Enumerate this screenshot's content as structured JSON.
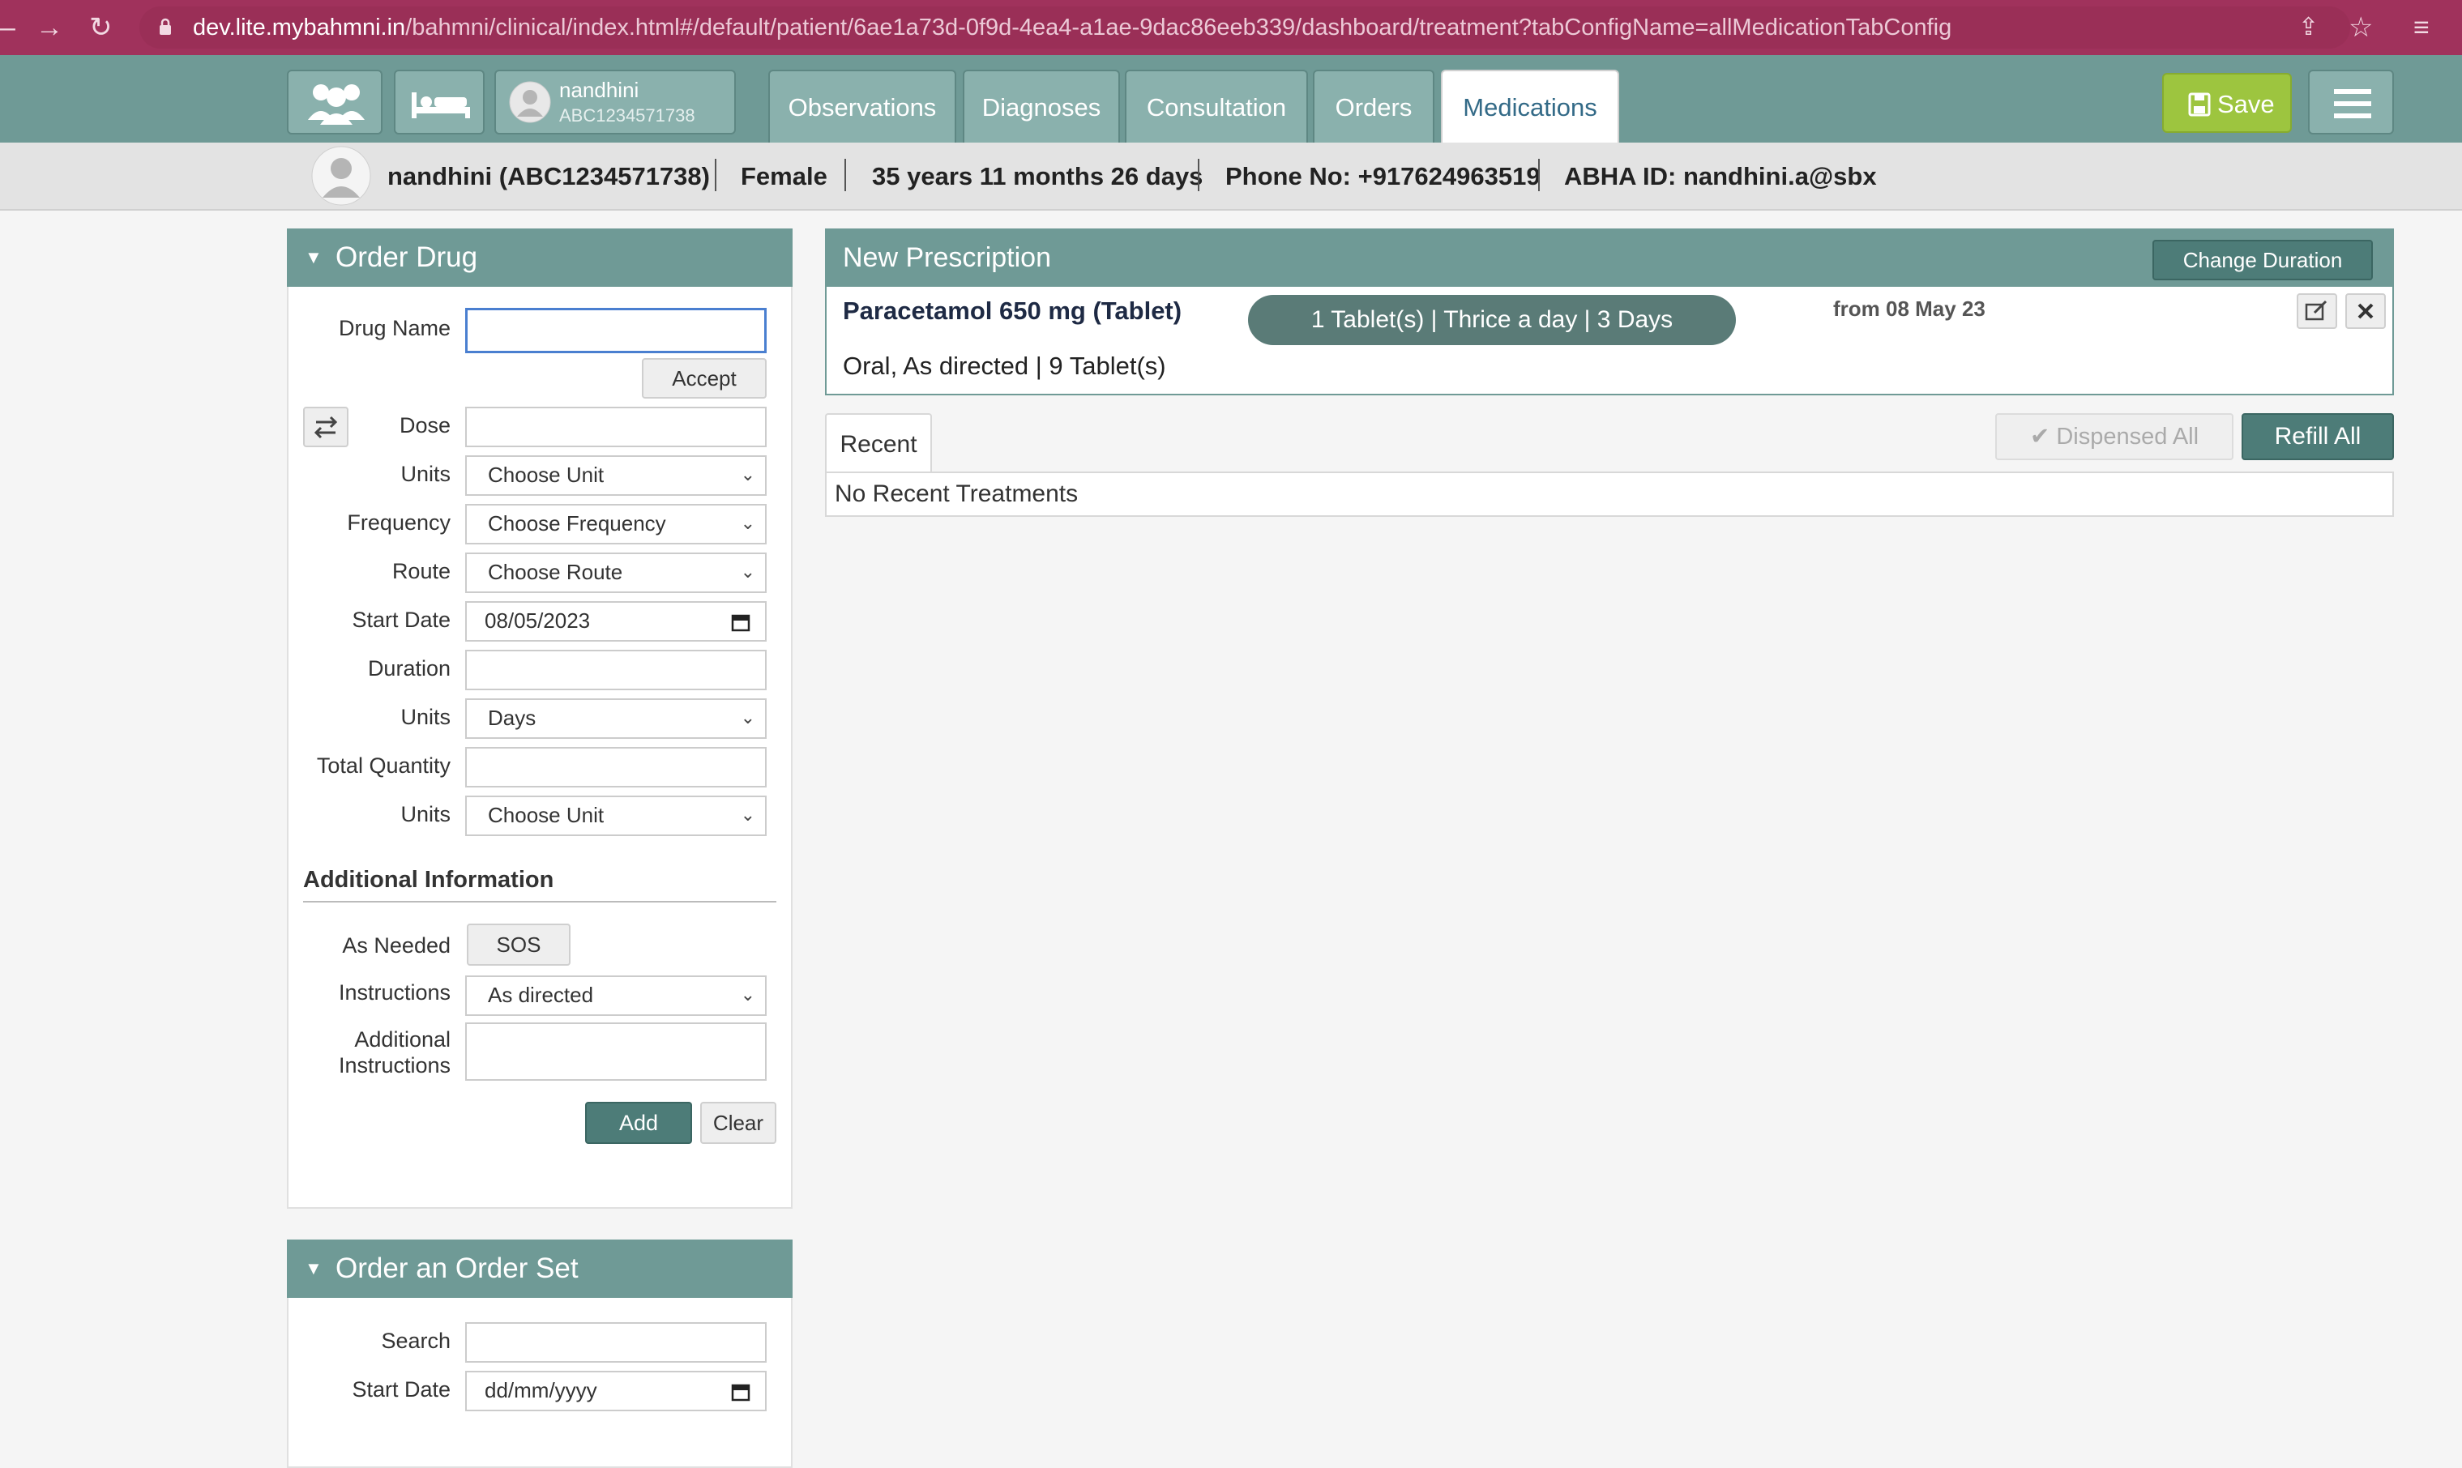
{
  "browser": {
    "url_domain": "dev.lite.mybahmni.in",
    "url_path": "/bahmni/clinical/index.html#/default/patient/6ae1a73d-0f9d-4ea4-a1ae-9dac86eeb339/dashboard/treatment?tabConfigName=allMedicationTabConfig"
  },
  "header": {
    "patient_name": "nandhini",
    "patient_id": "ABC1234571738",
    "tabs": [
      "Observations",
      "Diagnoses",
      "Consultation",
      "Orders",
      "Medications"
    ],
    "active_tab": "Medications",
    "save_label": "Save"
  },
  "patient_bar": {
    "name_id": "nandhini  (ABC1234571738)",
    "gender": "Female",
    "age": "35 years 11 months 26 days",
    "phone": "Phone No: +917624963519",
    "abha": "ABHA ID: nandhini.a@sbx"
  },
  "order_drug": {
    "title": "Order Drug",
    "drug_name_label": "Drug Name",
    "drug_name_value": "",
    "accept_label": "Accept",
    "dose_label": "Dose",
    "dose_value": "",
    "units_label": "Units",
    "units_value": "Choose Unit",
    "frequency_label": "Frequency",
    "frequency_value": "Choose Frequency",
    "route_label": "Route",
    "route_value": "Choose Route",
    "start_date_label": "Start Date",
    "start_date_value": "08/05/2023",
    "duration_label": "Duration",
    "duration_value": "",
    "duration_units_label": "Units",
    "duration_units_value": "Days",
    "total_quantity_label": "Total Quantity",
    "total_quantity_value": "",
    "quantity_units_label": "Units",
    "quantity_units_value": "Choose Unit",
    "additional_info_heading": "Additional Information",
    "as_needed_label": "As Needed",
    "sos_label": "SOS",
    "instructions_label": "Instructions",
    "instructions_value": "As directed",
    "additional_instructions_label_1": "Additional",
    "additional_instructions_label_2": "Instructions",
    "add_label": "Add",
    "clear_label": "Clear"
  },
  "order_set": {
    "title": "Order an Order Set",
    "search_label": "Search",
    "start_date_label": "Start Date",
    "start_date_placeholder": "dd/mm/yyyy"
  },
  "prescription": {
    "title": "New Prescription",
    "change_duration_label": "Change Duration",
    "drug": "Paracetamol 650 mg (Tablet)",
    "dosage_pill": "1 Tablet(s) | Thrice a day | 3 Days",
    "from_date": "from 08 May 23",
    "details": "Oral, As directed  |  9 Tablet(s)"
  },
  "recent": {
    "tab_label": "Recent",
    "dispensed_all_label": "Dispensed All",
    "refill_all_label": "Refill All",
    "empty_text": "No Recent Treatments"
  },
  "colors": {
    "browser_bar": "#a0325c",
    "header": "#6f9a96",
    "save_button": "#9dc53f",
    "active_tab_text": "#336a87"
  }
}
